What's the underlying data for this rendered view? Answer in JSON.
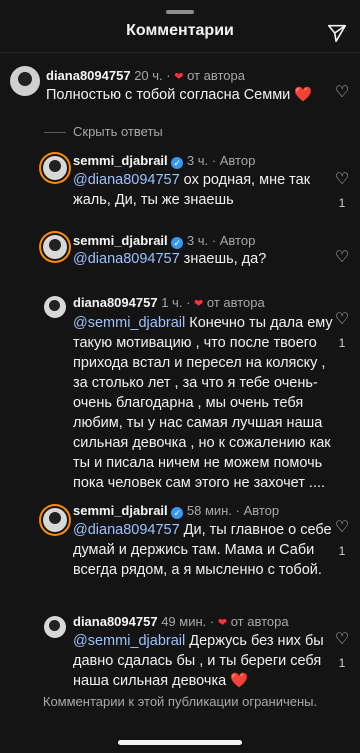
{
  "header": {
    "title": "Комментарии"
  },
  "hide_replies": "Скрыть ответы",
  "comments": [
    {
      "user": "diana8094757",
      "time": "20 ч.",
      "badge": "от автора",
      "mention": "",
      "text": "Полностью  с тобой согласна Семми",
      "emoji": "❤️",
      "likes": ""
    },
    {
      "user": "semmi_djabrail",
      "time": "3 ч.",
      "badge": "Автор",
      "mention": "@diana8094757",
      "text": " ох родная, мне так жаль, Ди, ты же знаешь",
      "likes": "1"
    },
    {
      "user": "semmi_djabrail",
      "time": "3 ч.",
      "badge": "Автор",
      "mention": "@diana8094757",
      "text": " знаешь, да?",
      "likes": ""
    },
    {
      "user": "diana8094757",
      "time": "1 ч.",
      "badge": "от автора",
      "mention": "@semmi_djabrail",
      "text": " Конечно  ты дала ему такую мотивацию , что после твоего прихода встал и пересел на коляску , за столько лет , за что я тебе очень-очень  благодарна , мы очень тебя любим,  ты у нас самая лучшая наша сильная девочка , но к сожалению  как ты и писала ничем не можем помочь пока человек сам этого не захочет ....",
      "likes": "1"
    },
    {
      "user": "semmi_djabrail",
      "time": "58 мин.",
      "badge": "Автор",
      "mention": "@diana8094757",
      "text": " Ди, ты главное о себе думай и держись там. Мама и Саби всегда рядом, а я мысленно с тобой.",
      "likes": "1"
    },
    {
      "user": "diana8094757",
      "time": "49 мин.",
      "badge": "от автора",
      "mention": "@semmi_djabrail",
      "text": " Держусь без них бы давно сдалась бы , и ты береги себя наша сильная девочка",
      "emoji": "❤️",
      "likes": "1"
    }
  ],
  "footer": "Комментарии к этой публикации ограничены.",
  "colors": {
    "background": "#141414",
    "mention": "#9ac3ff",
    "heart": "#ff3040",
    "verified": "#3897f0"
  },
  "icons": [
    "send-icon",
    "heart-outline-icon",
    "red-heart-icon",
    "verified-badge-icon"
  ]
}
